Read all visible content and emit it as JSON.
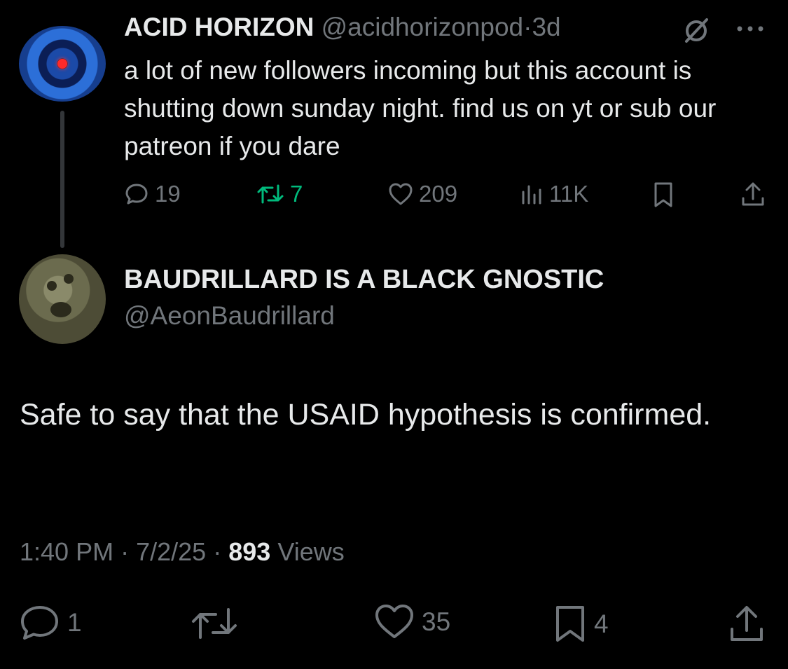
{
  "parent": {
    "name": "ACID HORIZON",
    "handle": "@acidhorizonpod",
    "sep": "·",
    "time": "3d",
    "text": "a lot of new followers incoming but this account is shutting down sunday night. find us on yt or sub our patreon if you dare",
    "replies": "19",
    "reposts": "7",
    "likes": "209",
    "views": "11K",
    "icons": [
      "grok-icon",
      "more-icon",
      "reply-icon",
      "repost-icon",
      "like-icon",
      "views-icon",
      "bookmark-icon",
      "share-icon"
    ]
  },
  "reply": {
    "name": "BAUDRILLARD IS A BLACK GNOSTIC",
    "handle": "@AeonBaudrillard",
    "text": "Safe to say that the USAID hypothesis is confirmed.",
    "time": "1:40 PM",
    "date": "7/2/25",
    "sep": "·",
    "views_count": "893",
    "views_label": "Views",
    "replies": "1",
    "likes": "35",
    "bookmarks": "4"
  },
  "colors": {
    "background": "#000000",
    "text": "#e7e9ea",
    "muted": "#71767b",
    "repost_active": "#00ba7c",
    "thread_line": "#333639"
  }
}
